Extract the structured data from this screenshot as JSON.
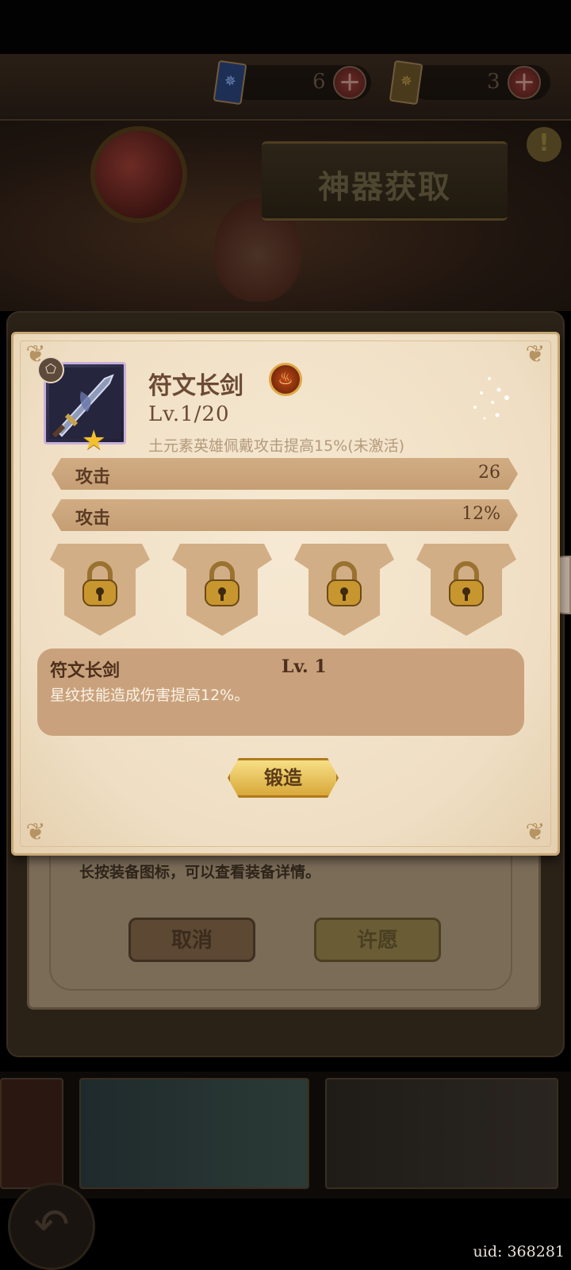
{
  "currency": [
    {
      "icon": "blue-card-icon",
      "count": "6",
      "color": "#233a66"
    },
    {
      "icon": "gold-card-icon",
      "count": "3",
      "color": "#5f4a24"
    }
  ],
  "banner": {
    "title": "神器获取"
  },
  "behind_dialog": {
    "hint": "长按装备图标，可以查看装备详情。",
    "cancel_label": "取消",
    "wish_label": "许愿"
  },
  "item": {
    "name": "符文长剑",
    "level": "Lv.1/20",
    "description": "土元素英雄佩戴攻击提高15%(未激活)",
    "stars": 1,
    "element": "fire-element-icon"
  },
  "stats": [
    {
      "label": "攻击",
      "value": "26"
    },
    {
      "label": "攻击",
      "value": "12%"
    }
  ],
  "rune_slots": [
    {
      "state": "locked"
    },
    {
      "state": "locked"
    },
    {
      "state": "locked"
    },
    {
      "state": "locked"
    }
  ],
  "skill": {
    "name": "符文长剑",
    "level": "Lv. 1",
    "description": "星纹技能造成伤害提高12%。"
  },
  "forge_label": "锻造",
  "footer": {
    "uid": "uid: 368281"
  },
  "colors": {
    "panel": "#f2e3c8",
    "bar": "#c9a27d",
    "accent_gold": "#e6b84a"
  }
}
